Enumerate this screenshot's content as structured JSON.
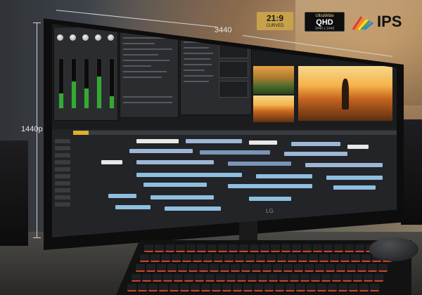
{
  "dimensions": {
    "width_label": "3440",
    "height_label": "1440p"
  },
  "badges": {
    "aspect": {
      "ratio": "21:9",
      "sub": "CURVED"
    },
    "ultrawide": {
      "line1": "UltraWide",
      "line2": "QHD",
      "line3": "3440 x 1440"
    },
    "panel": {
      "text": "IPS"
    }
  },
  "monitor": {
    "brand": "LG"
  },
  "colors": {
    "badge_gold": "#c8a24a",
    "timeline_clip": "#9db7d6",
    "playhead": "#d9b32d",
    "key_backlight": "#c9472a"
  },
  "icons": [
    "ips-color-fan-icon",
    "lg-logo"
  ]
}
